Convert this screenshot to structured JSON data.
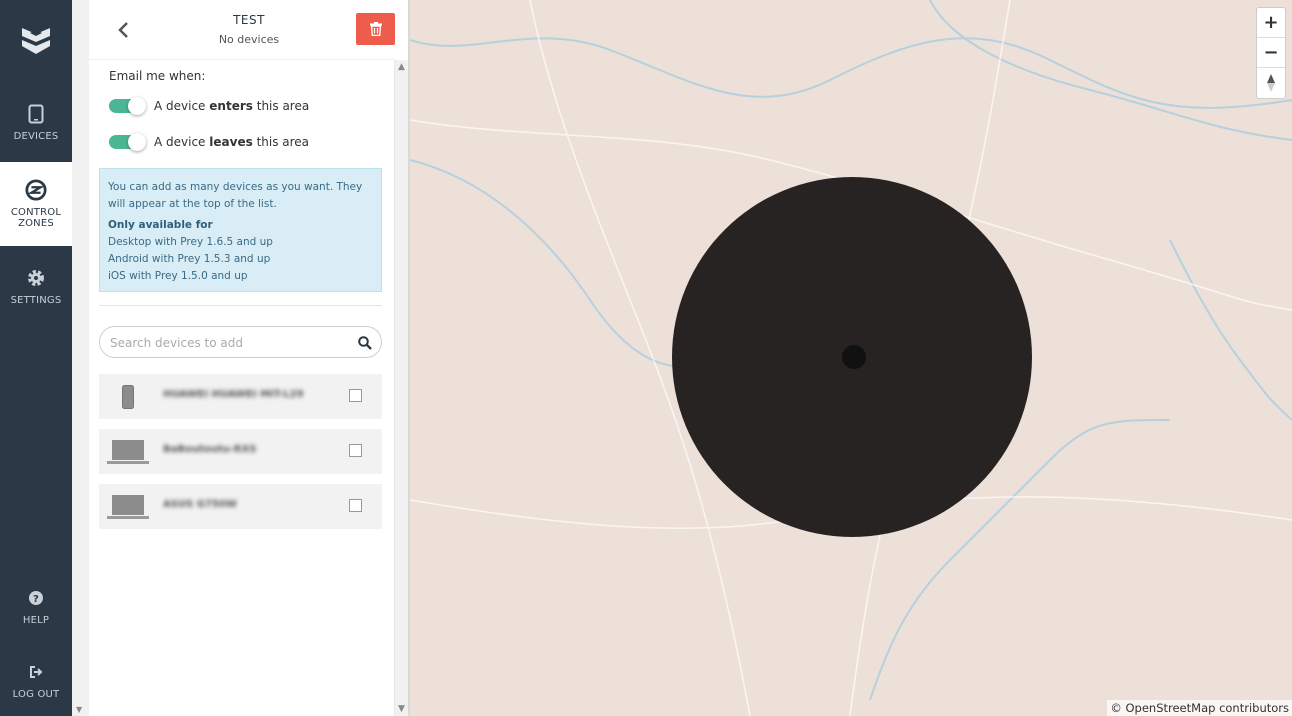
{
  "nav": {
    "items": [
      {
        "label": "DEVICES"
      },
      {
        "label_line1": "CONTROL",
        "label_line2": "ZONES"
      },
      {
        "label": "SETTINGS"
      },
      {
        "label": "HELP"
      },
      {
        "label": "LOG OUT"
      }
    ]
  },
  "zone": {
    "name": "TEST",
    "status": "No devices"
  },
  "notifications": {
    "label": "Email me when:",
    "enter": {
      "prefix": "A device ",
      "keyword": "enters",
      "suffix": " this area",
      "enabled": true
    },
    "leave": {
      "prefix": "A device ",
      "keyword": "leaves",
      "suffix": " this area",
      "enabled": true
    }
  },
  "info": {
    "text": "You can add as many devices as you want. They will appear at the top of the list.",
    "heading": "Only available for",
    "lines": [
      "Desktop with Prey 1.6.5 and up",
      "Android with Prey 1.5.3 and up",
      "iOS with Prey 1.5.0 and up"
    ]
  },
  "search": {
    "placeholder": "Search devices to add",
    "value": ""
  },
  "devices": [
    {
      "name": "HUAWEI HUAWEI MIT-L29",
      "type": "phone-icon",
      "checked": false
    },
    {
      "name": "BaBoutoutu-RXS",
      "type": "laptop-icon",
      "checked": false
    },
    {
      "name": "ASUS G750W",
      "type": "laptop-icon",
      "checked": false
    }
  ],
  "map": {
    "zoom_in": "+",
    "zoom_out": "−",
    "attribution": "© OpenStreetMap contributors",
    "zone_color": "#231f1e",
    "background": "#ede0d8"
  },
  "colors": {
    "nav": "#2b3845",
    "accent": "#4bb694",
    "danger": "#ee5c4c",
    "info_bg": "#d9edf7"
  }
}
